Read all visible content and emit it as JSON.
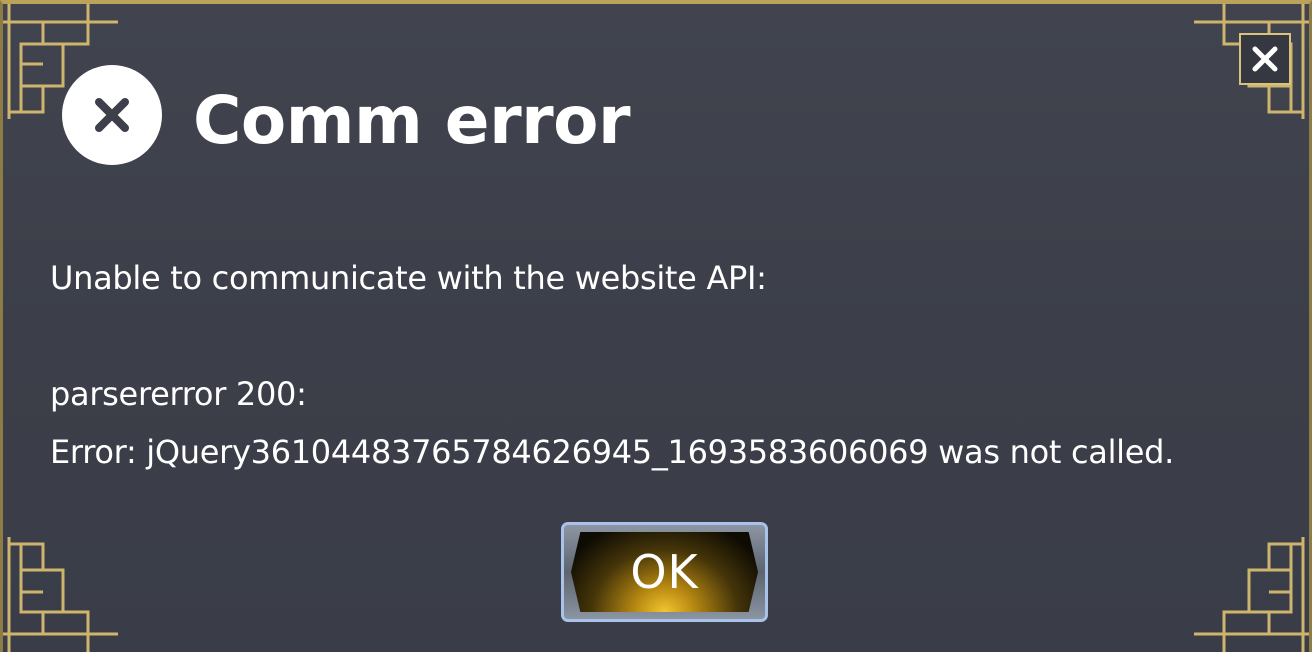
{
  "dialog": {
    "title": "Comm error",
    "title_icon": "error-x-icon",
    "close_icon": "close-icon",
    "message_line1": "Unable to communicate with the website API:",
    "message_line2": "parsererror 200:",
    "message_line3": "Error: jQuery36104483765784626945_1693583606069 was not called.",
    "ok_label": "OK"
  },
  "colors": {
    "background": "#3d404a",
    "gold_frame": "#c8b06a",
    "ok_button_border": "#a9c2ea",
    "ok_glow": "#f2c531",
    "text": "#ffffff"
  }
}
